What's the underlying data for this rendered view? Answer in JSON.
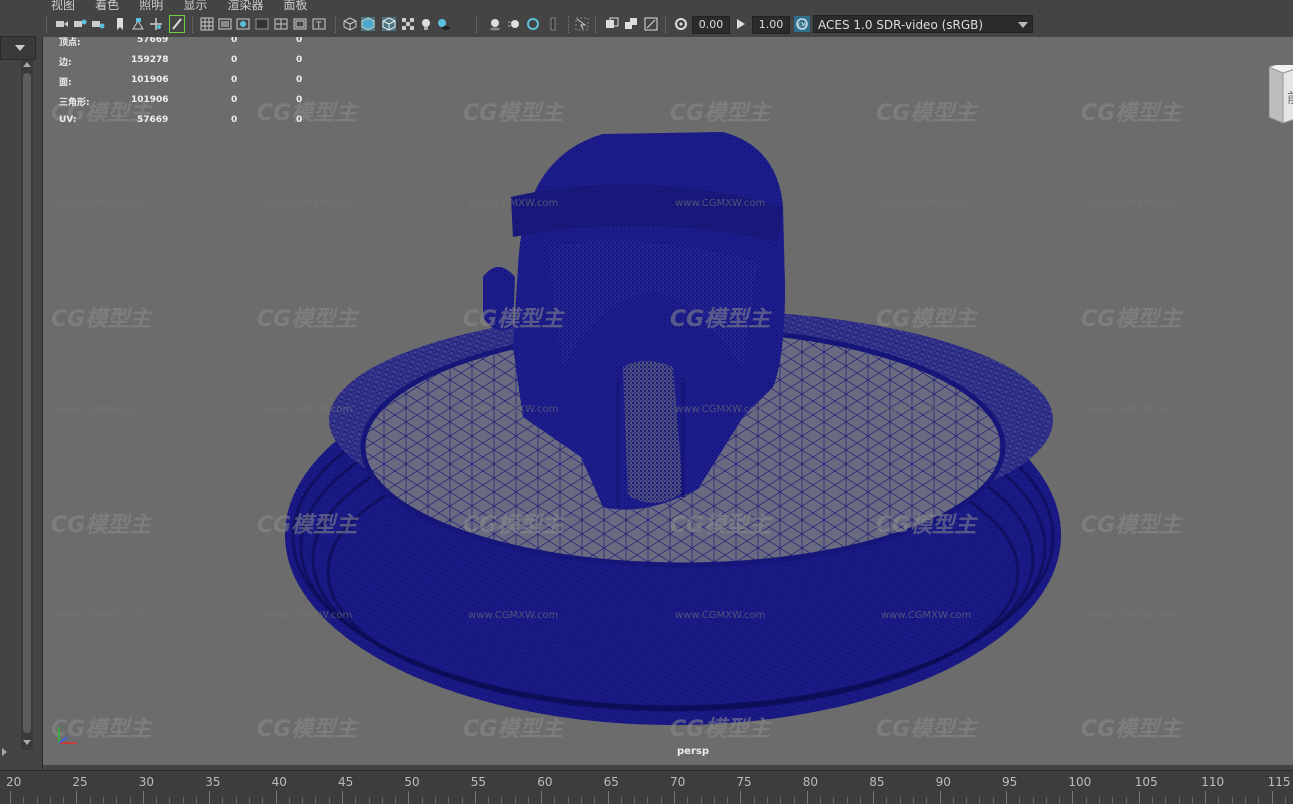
{
  "menu": [
    "视图",
    "着色",
    "照明",
    "显示",
    "渲染器",
    "面板"
  ],
  "toolbar": {
    "value_a": "0.00",
    "value_b": "1.00",
    "color_space": "ACES 1.0 SDR-video (sRGB)",
    "icons": [
      "camera-icon",
      "camera-lock-icon",
      "camera-attr-icon",
      "bookmark-icon",
      "image-plane-icon",
      "2d-pan-icon",
      "grease-pencil-icon",
      "grid-icon",
      "film-gate-icon",
      "resolution-gate-icon",
      "gate-mask-icon",
      "field-chart-icon",
      "safe-action-icon",
      "safe-title-icon",
      "wireframe-icon",
      "smooth-shade-icon",
      "wireframe-on-shaded-icon",
      "textured-icon",
      "lights-icon",
      "shadows-icon",
      "screen-space-ao-icon",
      "motion-blur-icon",
      "anti-alias-icon",
      "depth-of-field-icon",
      "isolate-select-icon",
      "xray-icon",
      "xray-joints-icon",
      "xray-components-icon",
      "exposure-icon",
      "gamma-icon",
      "color-management-icon"
    ]
  },
  "hud": {
    "rows": [
      {
        "label": "顶点:",
        "v1": "57669",
        "v2": "0",
        "v3": "0"
      },
      {
        "label": "边:",
        "v1": "159278",
        "v2": "0",
        "v3": "0"
      },
      {
        "label": "面:",
        "v1": "101906",
        "v2": "0",
        "v3": "0"
      },
      {
        "label": "三角形:",
        "v1": "101906",
        "v2": "0",
        "v3": "0"
      },
      {
        "label": "UV:",
        "v1": "57669",
        "v2": "0",
        "v3": "0"
      }
    ]
  },
  "viewport": {
    "camera_label": "persp",
    "viewcube_label": "前",
    "watermark_logo": "CG模型主",
    "watermark_url": "www.CGMXW.com",
    "wire_color": "#15157a"
  },
  "timeslider": {
    "labels": [
      "20",
      "25",
      "30",
      "35",
      "40",
      "45",
      "50",
      "55",
      "60",
      "65",
      "70",
      "75",
      "80",
      "85",
      "90",
      "95",
      "100",
      "105",
      "110",
      "115"
    ]
  }
}
